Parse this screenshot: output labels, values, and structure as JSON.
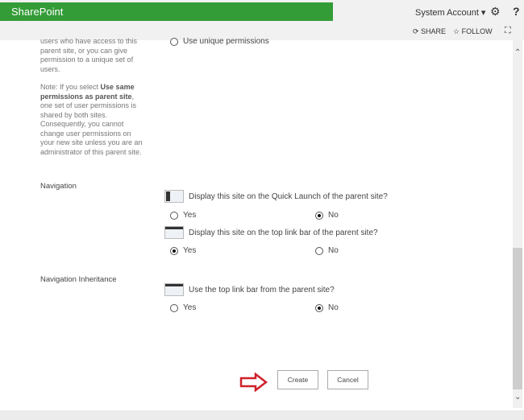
{
  "suite": {
    "brand": "SharePoint",
    "account": "System Account ▾",
    "gear_icon": "gear-icon",
    "help": "?"
  },
  "actions": {
    "share": "SHARE",
    "follow": "FOLLOW"
  },
  "permissions": {
    "desc1": "users who have access to this parent site, or you can give permission to a unique set of users.",
    "note_prefix": "Note: If you select ",
    "note_bold": "Use same permissions as parent site",
    "note_suffix": ", one set of user permissions is shared by both sites. Consequently, you cannot change user permissions on your new site unless you are an administrator of this parent site.",
    "unique_option": "Use unique permissions"
  },
  "navigation": {
    "label": "Navigation",
    "quick_launch": {
      "question": "Display this site on the Quick Launch of the parent site?",
      "yes": "Yes",
      "no": "No",
      "selected": "No"
    },
    "top_link": {
      "question": "Display this site on the top link bar of the parent site?",
      "yes": "Yes",
      "no": "No",
      "selected": "Yes"
    }
  },
  "inheritance": {
    "label": "Navigation Inheritance",
    "question": "Use the top link bar from the parent site?",
    "yes": "Yes",
    "no": "No",
    "selected": "No"
  },
  "buttons": {
    "create": "Create",
    "cancel": "Cancel"
  }
}
